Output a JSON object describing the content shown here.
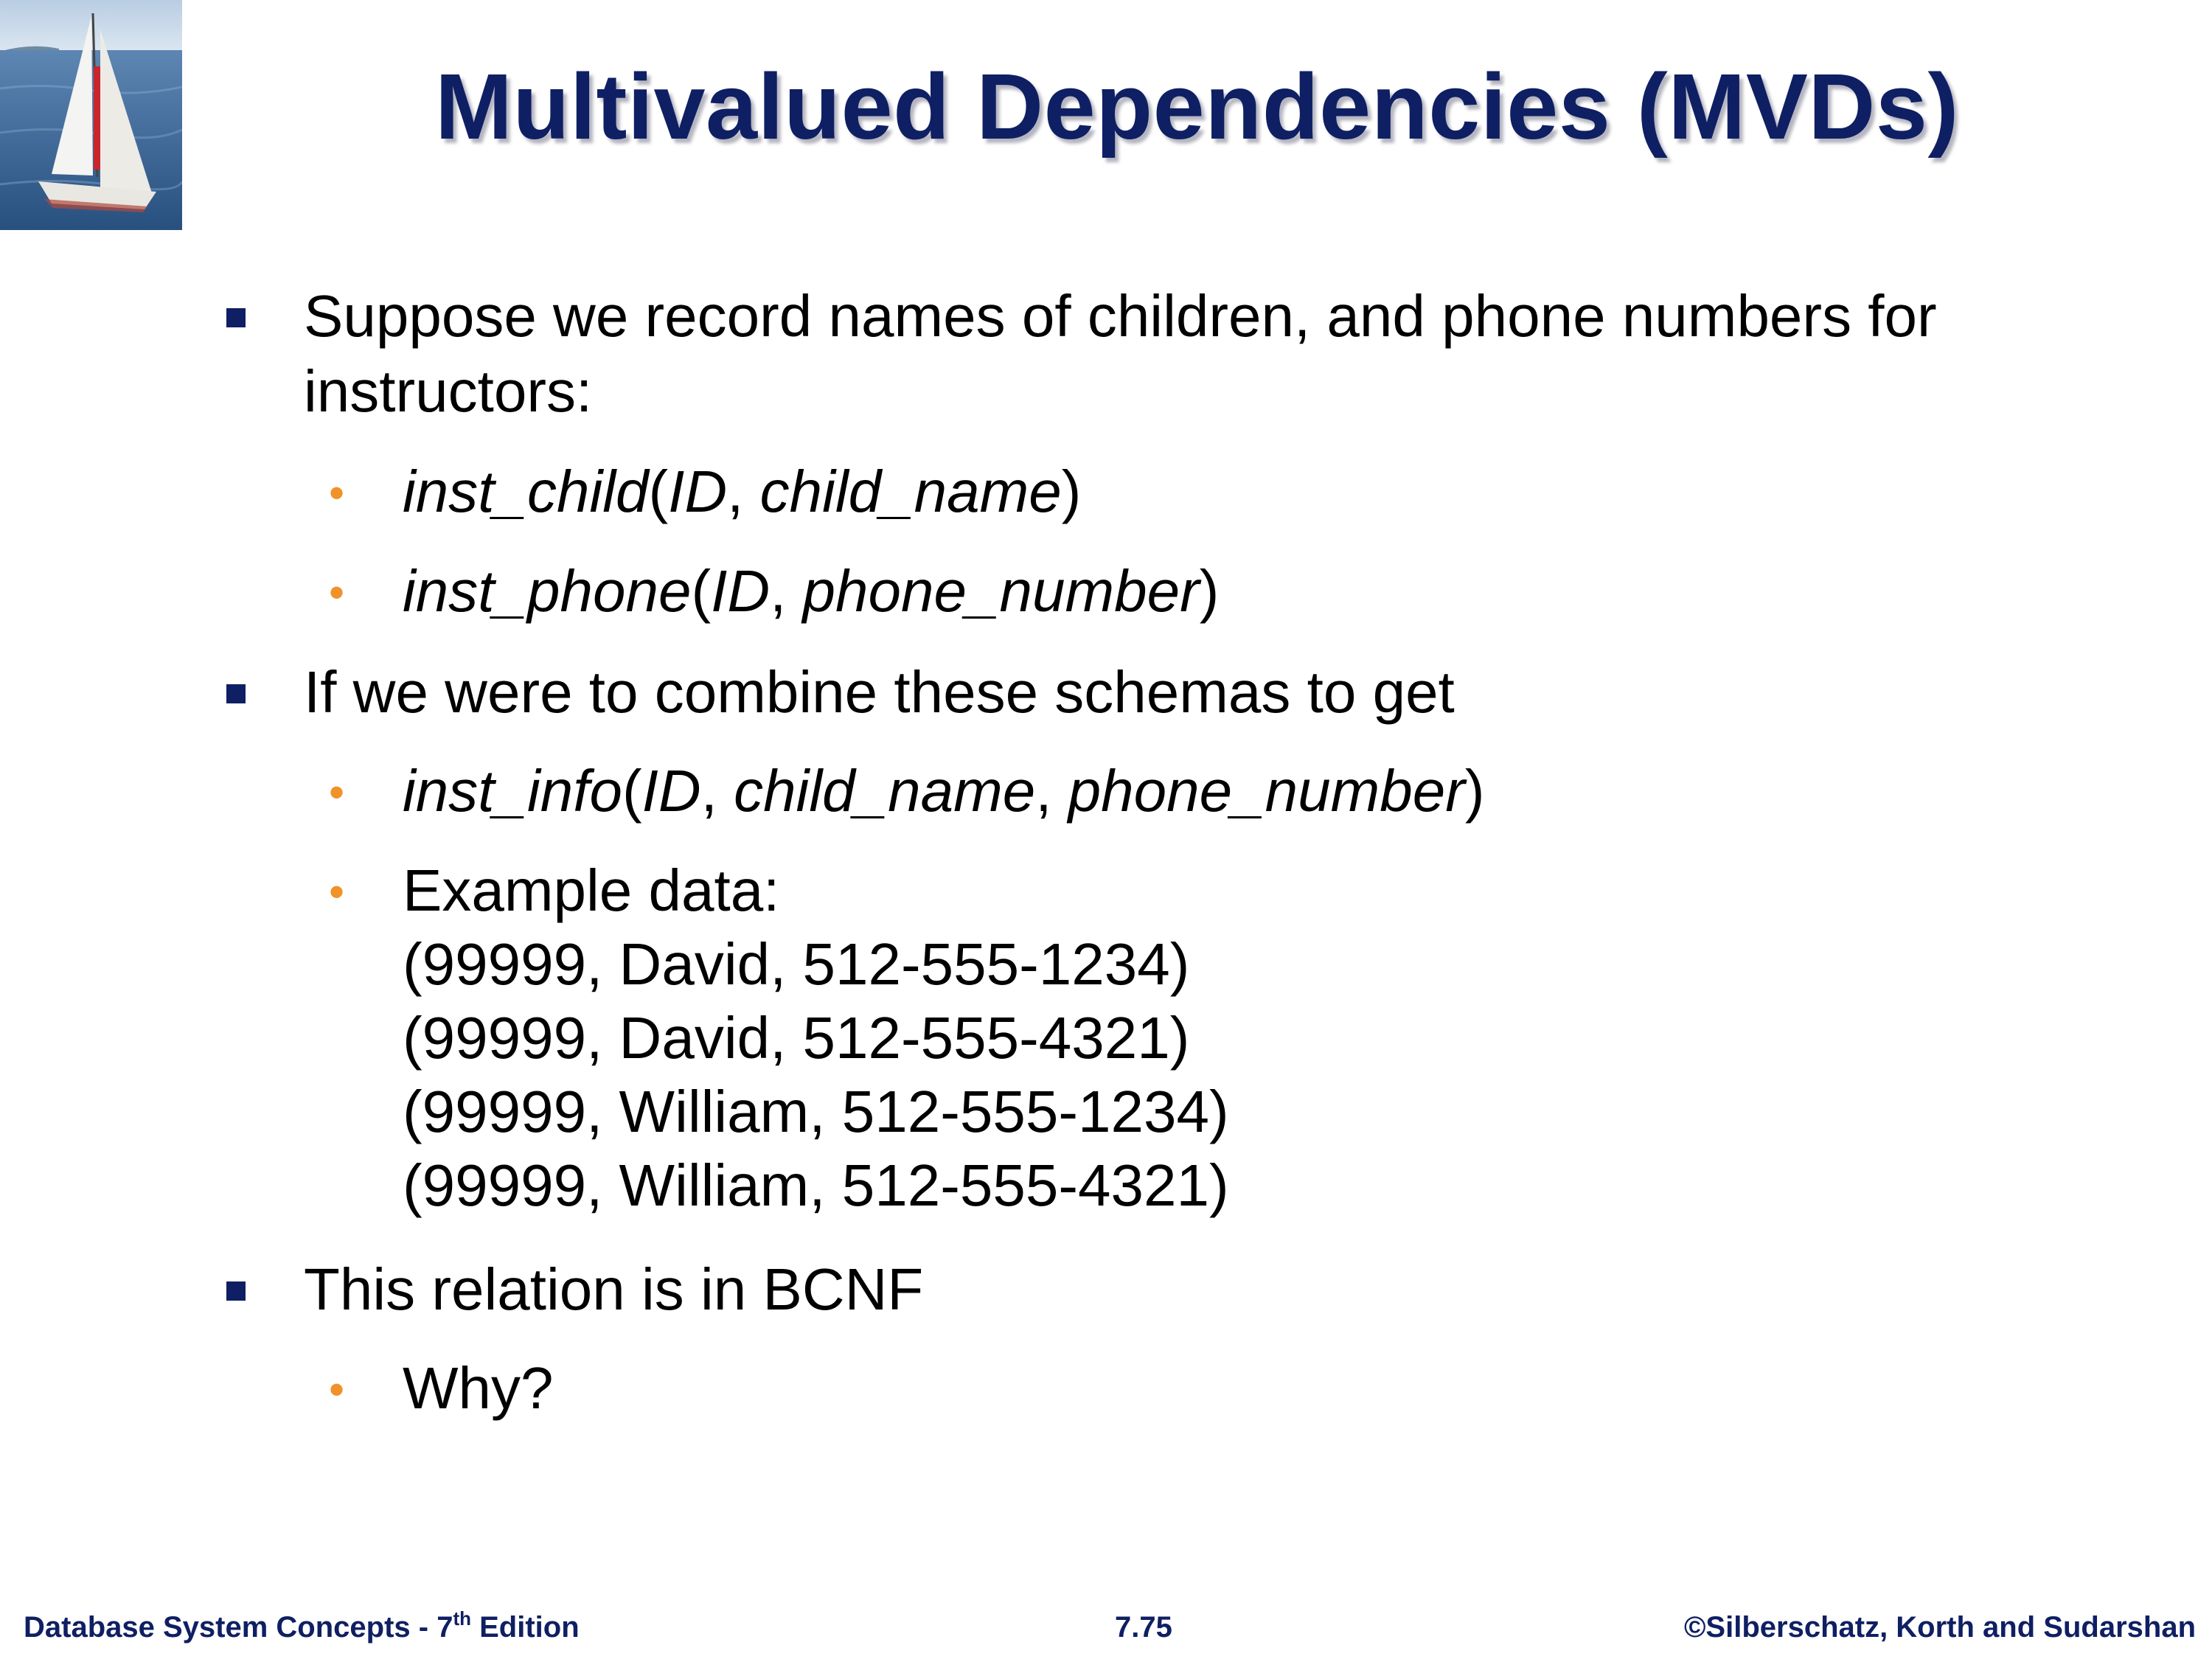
{
  "slide": {
    "title": "Multivalued Dependencies (MVDs)",
    "bullet1": {
      "line1": "Suppose we record names of children, and phone numbers for",
      "line2": "instructors:"
    },
    "sub1": {
      "rel": "inst_child",
      "open": "(",
      "attr1": "ID",
      "sep1": ", ",
      "attr2": "child_name",
      "close": ")"
    },
    "sub2": {
      "rel": "inst_phone",
      "open": "(",
      "attr1": "ID",
      "sep1": ", ",
      "attr2": "phone_number",
      "close": ")"
    },
    "bullet2": "If we were to combine these schemas to get",
    "sub3": {
      "rel": "inst_info",
      "open": "(",
      "attr1": "ID",
      "sep1": ", ",
      "attr2": "child_name",
      "sep2": ", ",
      "attr3": "phone_number",
      "close": ")"
    },
    "example": {
      "label": "Example data:",
      "rows": [
        "(99999, David, 512-555-1234)",
        "(99999, David, 512-555-4321)",
        "(99999, William, 512-555-1234)",
        "(99999, William, 512-555-4321)"
      ]
    },
    "bullet3": "This relation is in BCNF",
    "sub4": "Why?"
  },
  "footer": {
    "left_main": "Database System Concepts - 7",
    "left_sup": "th",
    "left_tail": " Edition",
    "page": "7.75",
    "copyright": "©Silberschatz, Korth and Sudarshan"
  },
  "colors": {
    "title": "#0f1f63",
    "level1_marker": "#0f1f63",
    "level2_marker": "#f0922a"
  },
  "icons": {
    "logo": "sailboat-photo",
    "level1_bullet": "square-bullet",
    "level2_bullet": "round-bullet"
  }
}
